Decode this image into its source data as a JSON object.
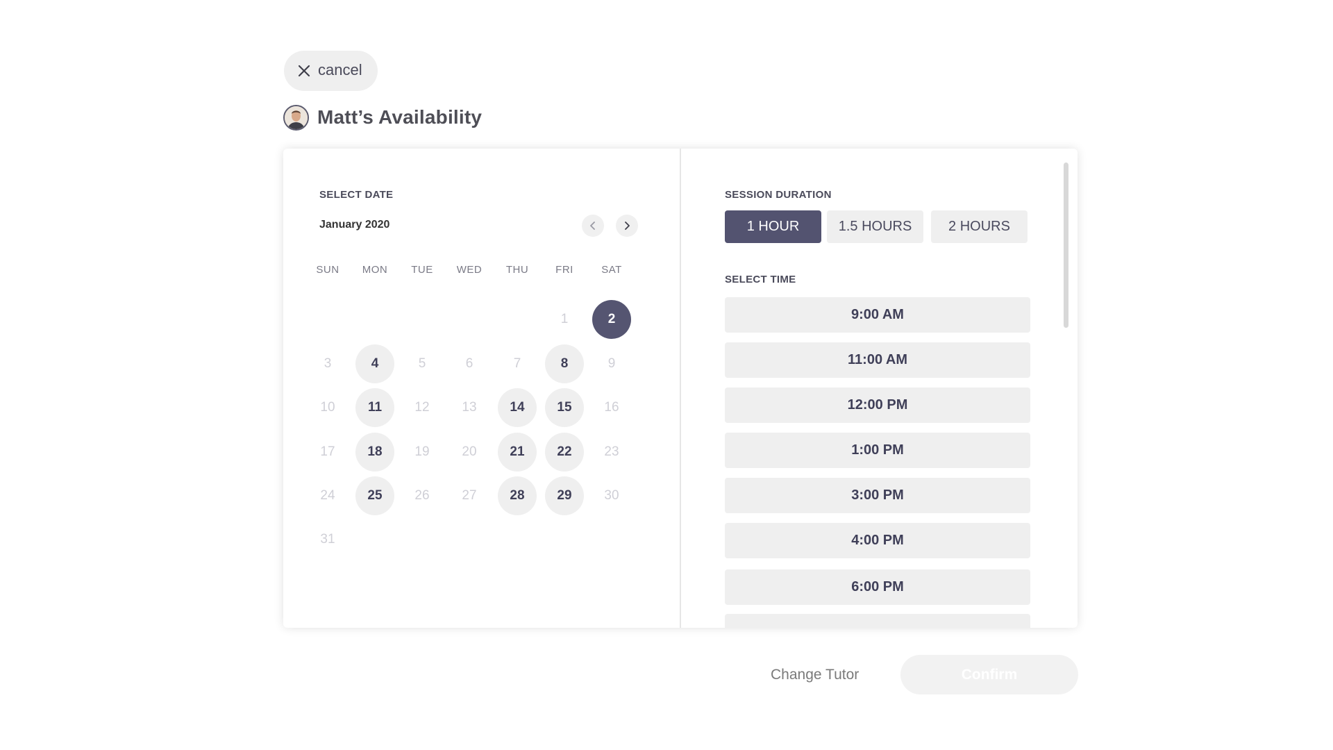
{
  "cancel": {
    "label": "cancel",
    "icon": "close-icon"
  },
  "page_title": "Matt’s Availability",
  "calendar": {
    "section_label": "SELECT DATE",
    "month": "January 2020",
    "weekdays": [
      "SUN",
      "MON",
      "TUE",
      "WED",
      "THU",
      "FRI",
      "SAT"
    ],
    "days": [
      {
        "n": "1",
        "state": "disabled"
      },
      {
        "n": "2",
        "state": "selected"
      },
      {
        "n": "3",
        "state": "disabled"
      },
      {
        "n": "4",
        "state": "available"
      },
      {
        "n": "5",
        "state": "disabled"
      },
      {
        "n": "6",
        "state": "disabled"
      },
      {
        "n": "7",
        "state": "disabled"
      },
      {
        "n": "8",
        "state": "available"
      },
      {
        "n": "9",
        "state": "disabled"
      },
      {
        "n": "10",
        "state": "disabled"
      },
      {
        "n": "11",
        "state": "available"
      },
      {
        "n": "12",
        "state": "disabled"
      },
      {
        "n": "13",
        "state": "disabled"
      },
      {
        "n": "14",
        "state": "available"
      },
      {
        "n": "15",
        "state": "available"
      },
      {
        "n": "16",
        "state": "disabled"
      },
      {
        "n": "17",
        "state": "disabled"
      },
      {
        "n": "18",
        "state": "available"
      },
      {
        "n": "19",
        "state": "disabled"
      },
      {
        "n": "20",
        "state": "disabled"
      },
      {
        "n": "21",
        "state": "available"
      },
      {
        "n": "22",
        "state": "available"
      },
      {
        "n": "23",
        "state": "disabled"
      },
      {
        "n": "24",
        "state": "disabled"
      },
      {
        "n": "25",
        "state": "available"
      },
      {
        "n": "26",
        "state": "disabled"
      },
      {
        "n": "27",
        "state": "disabled"
      },
      {
        "n": "28",
        "state": "available"
      },
      {
        "n": "29",
        "state": "available"
      },
      {
        "n": "30",
        "state": "disabled"
      },
      {
        "n": "31",
        "state": "disabled"
      }
    ]
  },
  "session": {
    "duration_label": "SESSION DURATION",
    "durations": [
      {
        "label": "1 HOUR",
        "active": true
      },
      {
        "label": "1.5 HOURS",
        "active": false
      },
      {
        "label": "2 HOURS",
        "active": false
      }
    ],
    "time_label": "SELECT TIME",
    "times": [
      "9:00 AM",
      "11:00 AM",
      "12:00 PM",
      "1:00 PM",
      "3:00 PM",
      "4:00 PM",
      "6:00 PM",
      ""
    ]
  },
  "footer": {
    "change_tutor": "Change Tutor",
    "confirm": "Confirm"
  },
  "colors": {
    "accent": "#555571",
    "chip_bg": "#efefef",
    "disabled_text": "#cfcfd6"
  }
}
